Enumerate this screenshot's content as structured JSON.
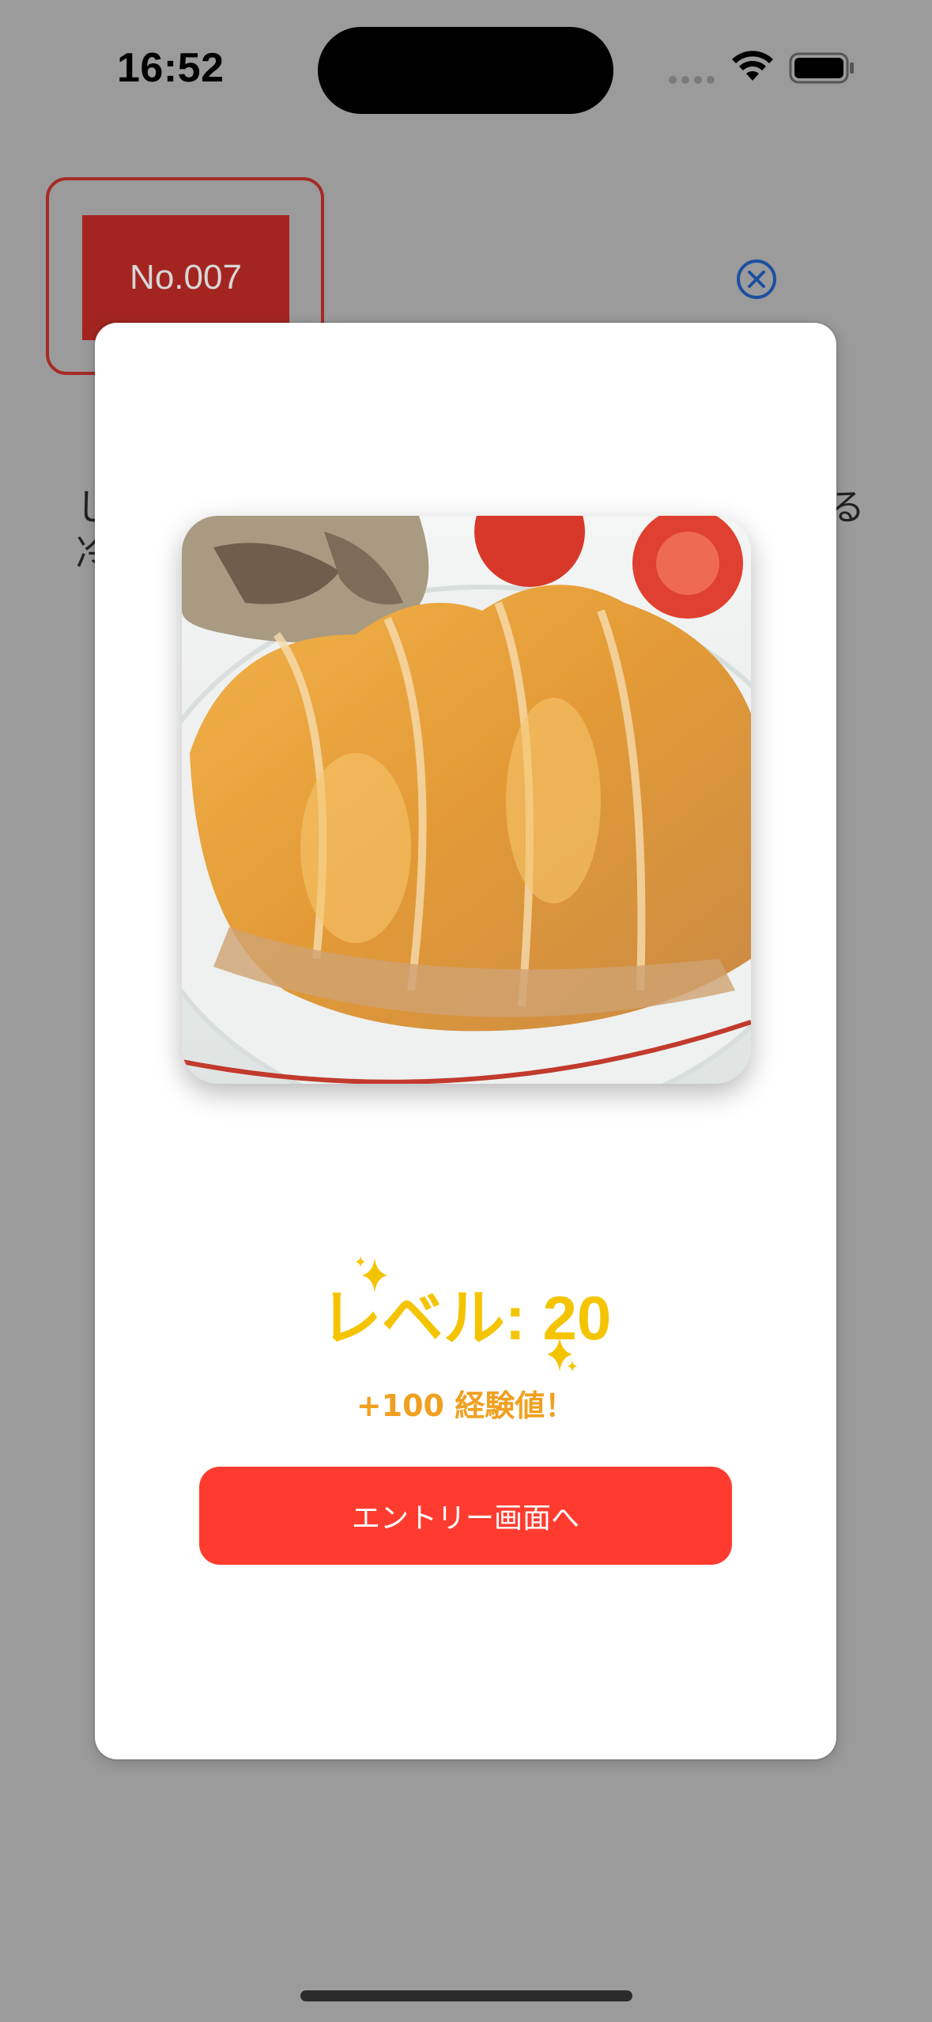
{
  "status_bar": {
    "time": "16:52",
    "wifi_icon": "wifi-icon",
    "battery_icon": "battery-icon"
  },
  "background_page": {
    "number_badge": "No.007",
    "close_icon": "close-circle-icon",
    "text_left_line1": "し",
    "text_left_line2": "冷",
    "text_right_line1": "る"
  },
  "modal": {
    "image_icon": "food-photo",
    "level_text": "レベル: 20",
    "exp_text": "+100 経験値！",
    "entry_button_label": "エントリー画面へ"
  },
  "colors": {
    "overlay": "#9b9b9b",
    "badge": "#a42520",
    "level": "#f5c400",
    "exp": "#f0a020",
    "button": "#ff3b30"
  }
}
